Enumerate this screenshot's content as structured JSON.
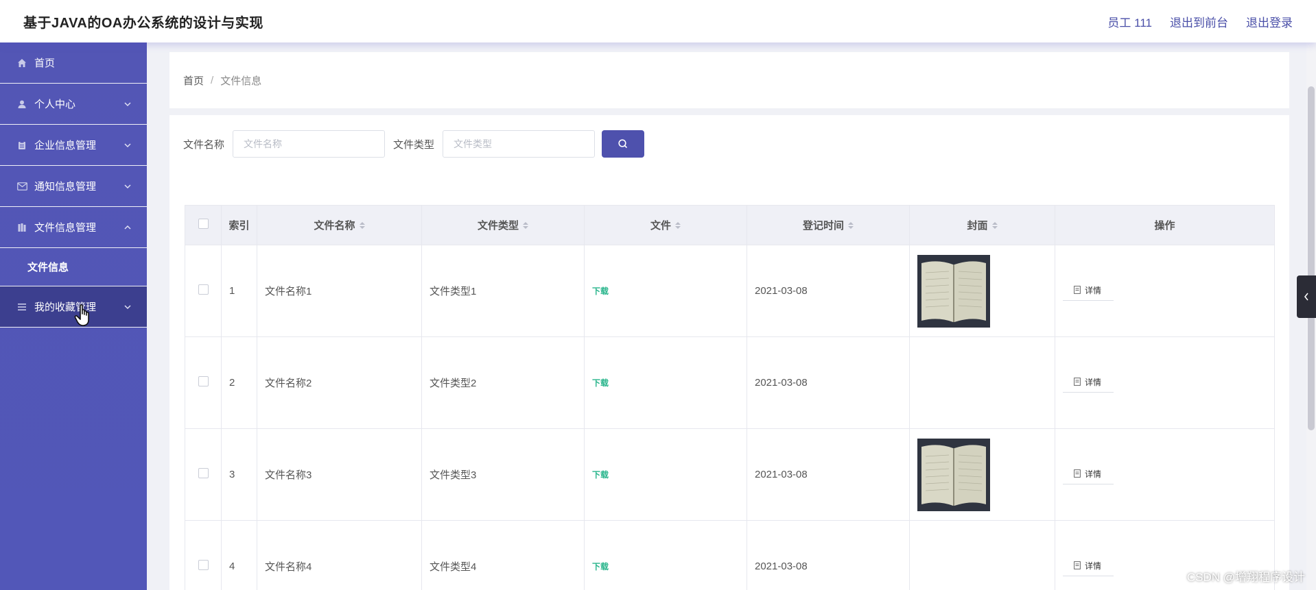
{
  "header": {
    "title": "基于JAVA的OA办公系统的设计与实现",
    "user": "员工 111",
    "back_to_front": "退出到前台",
    "logout": "退出登录"
  },
  "sidebar": {
    "items": [
      {
        "label": "首页",
        "icon": "home-icon"
      },
      {
        "label": "个人中心",
        "icon": "user-icon"
      },
      {
        "label": "企业信息管理",
        "icon": "clipboard-icon"
      },
      {
        "label": "通知信息管理",
        "icon": "mail-icon"
      },
      {
        "label": "文件信息管理",
        "icon": "archive-icon",
        "expanded": true
      },
      {
        "label": "我的收藏管理",
        "icon": "list-icon"
      }
    ],
    "submenu": {
      "label": "文件信息"
    }
  },
  "breadcrumb": {
    "home": "首页",
    "separator": "/",
    "current": "文件信息"
  },
  "search": {
    "name_label": "文件名称",
    "name_placeholder": "文件名称",
    "type_label": "文件类型",
    "type_placeholder": "文件类型"
  },
  "table": {
    "headers": {
      "index": "索引",
      "name": "文件名称",
      "type": "文件类型",
      "file": "文件",
      "date": "登记时间",
      "cover": "封面",
      "action": "操作"
    },
    "rows": [
      {
        "index": "1",
        "name": "文件名称1",
        "type": "文件类型1",
        "file": "下载",
        "date": "2021-03-08",
        "cover": "book",
        "action": "详情"
      },
      {
        "index": "2",
        "name": "文件名称2",
        "type": "文件类型2",
        "file": "下载",
        "date": "2021-03-08",
        "cover": "strip",
        "action": "详情"
      },
      {
        "index": "3",
        "name": "文件名称3",
        "type": "文件类型3",
        "file": "下载",
        "date": "2021-03-08",
        "cover": "book",
        "action": "详情"
      },
      {
        "index": "4",
        "name": "文件名称4",
        "type": "文件类型4",
        "file": "下载",
        "date": "2021-03-08",
        "cover": "strip",
        "action": "详情"
      }
    ]
  },
  "watermark": "CSDN @增翔程序设计",
  "colors": {
    "sidebar": "#5356b5",
    "accent": "#4e51ad",
    "download": "#29b58c"
  }
}
